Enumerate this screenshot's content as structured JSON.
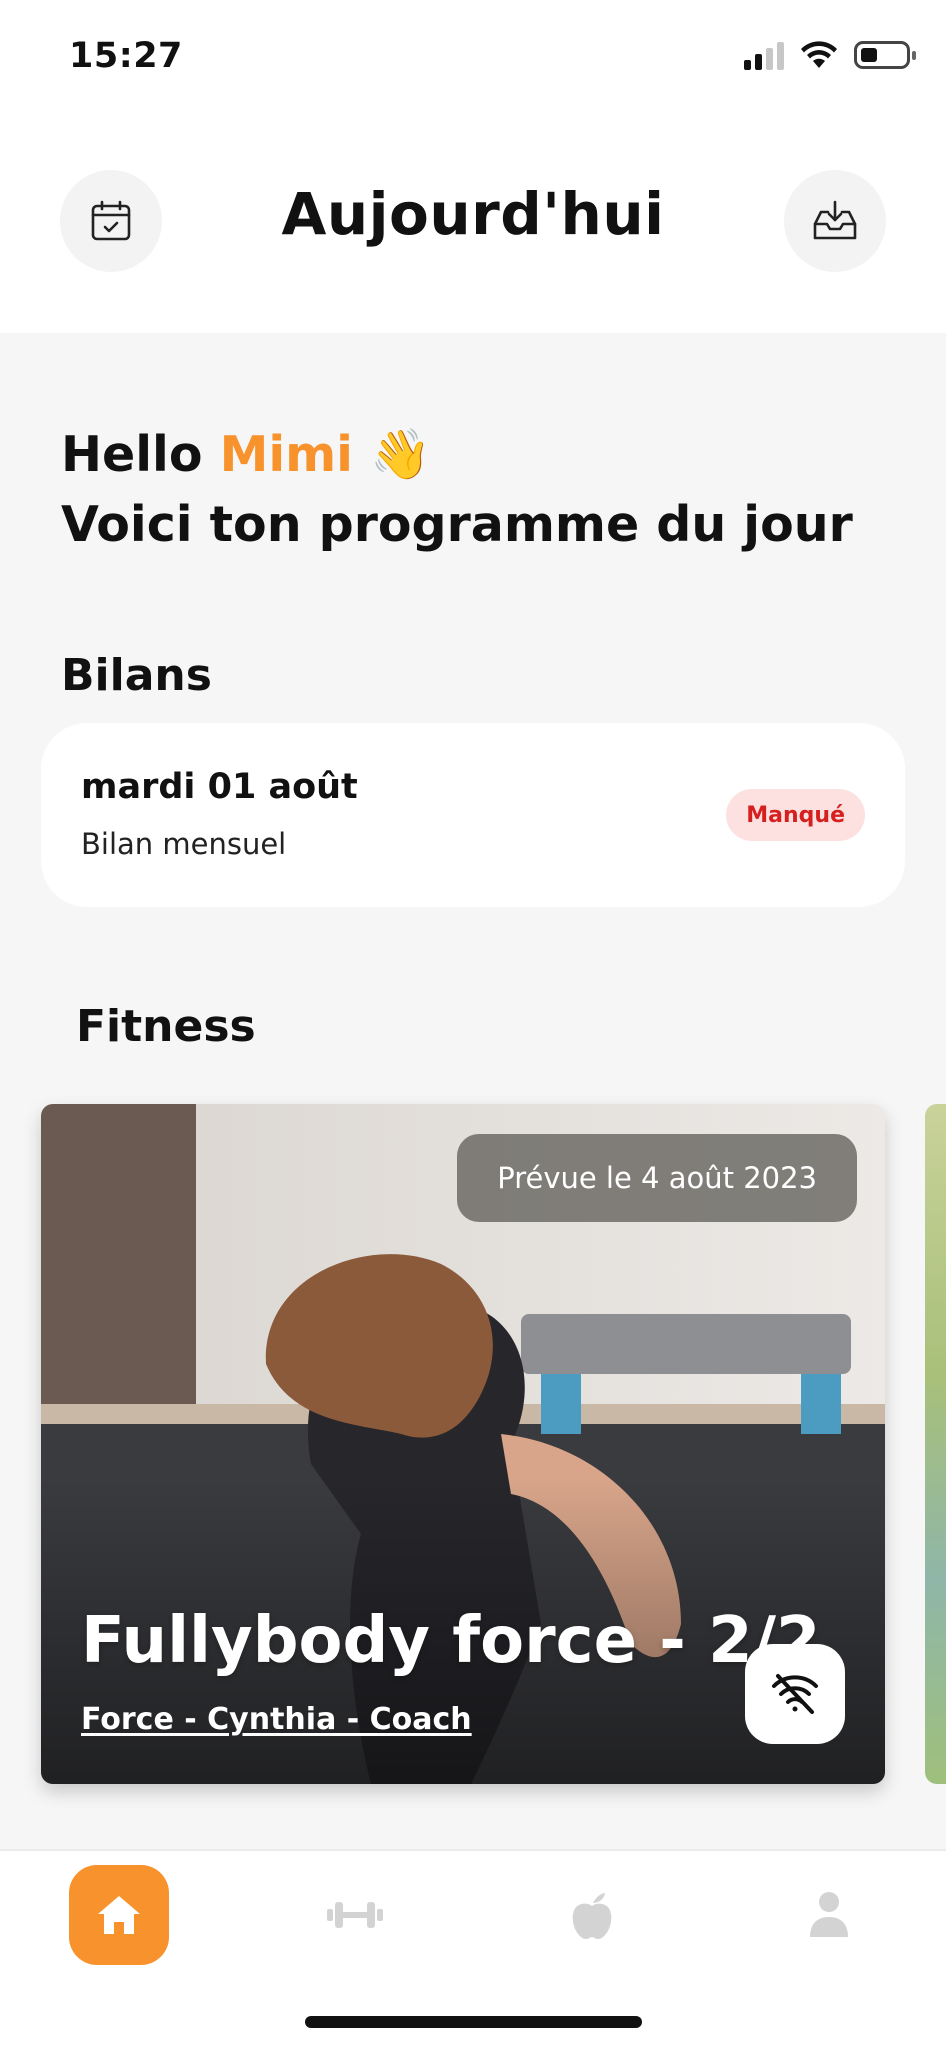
{
  "status_bar": {
    "time": "15:27"
  },
  "header": {
    "title": "Aujourd'hui",
    "left_icon": "calendar-check-icon",
    "right_icon": "inbox-download-icon"
  },
  "greeting": {
    "hello": "Hello",
    "name": "Mimi",
    "emoji": "👋",
    "subtitle": "Voici ton programme du jour"
  },
  "bilans": {
    "section_title": "Bilans",
    "card": {
      "date": "mardi 01 août",
      "label": "Bilan mensuel",
      "status": "Manqué"
    }
  },
  "fitness": {
    "section_title": "Fitness",
    "card": {
      "scheduled": "Prévue le 4 août 2023",
      "title": "Fullybody force - 2/2",
      "subtitle": "Force - Cynthia - Coach",
      "offline_icon": "wifi-off-icon"
    }
  },
  "tabbar": {
    "items": [
      {
        "name": "home",
        "icon": "home-icon",
        "active": true
      },
      {
        "name": "fitness",
        "icon": "dumbbell-icon",
        "active": false
      },
      {
        "name": "nutrition",
        "icon": "apple-icon",
        "active": false
      },
      {
        "name": "profile",
        "icon": "user-icon",
        "active": false
      }
    ]
  },
  "colors": {
    "accent": "#f7922c",
    "badge_bg": "#fde1e1",
    "badge_text": "#d62020"
  }
}
